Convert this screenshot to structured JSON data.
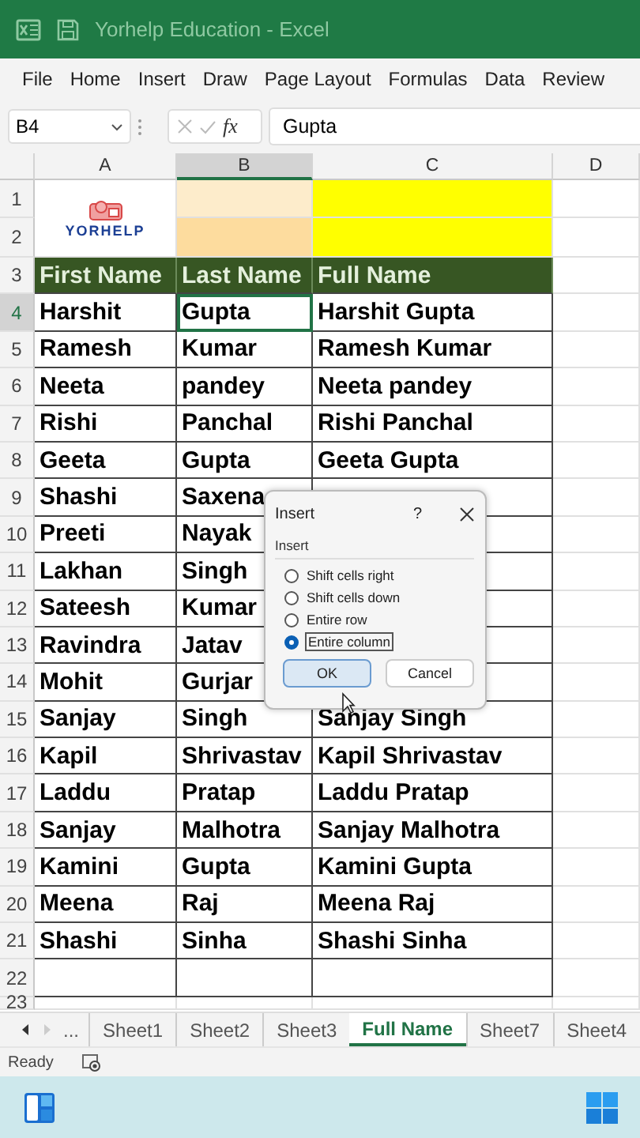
{
  "title_bar": {
    "title": "Yorhelp Education  -  Excel"
  },
  "menu": [
    "File",
    "Home",
    "Insert",
    "Draw",
    "Page Layout",
    "Formulas",
    "Data",
    "Review"
  ],
  "formula_bar": {
    "name_box": "B4",
    "function_label": "fx",
    "formula": "Gupta"
  },
  "columns": [
    {
      "label": "A",
      "selected": false
    },
    {
      "label": "B",
      "selected": true
    },
    {
      "label": "C",
      "selected": false
    },
    {
      "label": "D",
      "selected": false
    }
  ],
  "logo": {
    "text": "YORHELP"
  },
  "rows": [
    {
      "number": "1",
      "selected": false,
      "kind": "banner",
      "fills": [
        {
          "color": "#fdeccb"
        },
        {
          "color": "#ffff00"
        }
      ]
    },
    {
      "number": "2",
      "selected": false,
      "kind": "banner",
      "fills": [
        {
          "color": "#fddc9e"
        },
        {
          "color": "#ffff00"
        }
      ]
    },
    {
      "number": "3",
      "selected": false,
      "kind": "header",
      "cells": [
        "First Name",
        "Last Name",
        "Full Name"
      ]
    },
    {
      "number": "4",
      "selected": true,
      "kind": "data",
      "cells": [
        "Harshit",
        "Gupta",
        "Harshit Gupta"
      ]
    },
    {
      "number": "5",
      "selected": false,
      "kind": "data",
      "cells": [
        "Ramesh",
        "Kumar",
        "Ramesh Kumar"
      ]
    },
    {
      "number": "6",
      "selected": false,
      "kind": "data",
      "cells": [
        "Neeta",
        "pandey",
        "Neeta pandey"
      ]
    },
    {
      "number": "7",
      "selected": false,
      "kind": "data",
      "cells": [
        "Rishi",
        "Panchal",
        "Rishi Panchal"
      ]
    },
    {
      "number": "8",
      "selected": false,
      "kind": "data",
      "cells": [
        "Geeta",
        "Gupta",
        "Geeta Gupta"
      ]
    },
    {
      "number": "9",
      "selected": false,
      "kind": "data",
      "cells": [
        "Shashi",
        "Saxena"
      ]
    },
    {
      "number": "10",
      "selected": false,
      "kind": "data",
      "cells": [
        "Preeti",
        "Nayak"
      ]
    },
    {
      "number": "11",
      "selected": false,
      "kind": "data",
      "cells": [
        "Lakhan",
        "Singh"
      ]
    },
    {
      "number": "12",
      "selected": false,
      "kind": "data",
      "cells": [
        "Sateesh",
        "Kumar"
      ]
    },
    {
      "number": "13",
      "selected": false,
      "kind": "data",
      "cells": [
        "Ravindra",
        "Jatav"
      ]
    },
    {
      "number": "14",
      "selected": false,
      "kind": "data",
      "cells": [
        "Mohit",
        "Gurjar"
      ]
    },
    {
      "number": "15",
      "selected": false,
      "kind": "data",
      "cells": [
        "Sanjay",
        "Singh",
        "Sanjay Singh"
      ]
    },
    {
      "number": "16",
      "selected": false,
      "kind": "data",
      "cells": [
        "Kapil",
        "Shrivastav",
        "Kapil Shrivastav"
      ]
    },
    {
      "number": "17",
      "selected": false,
      "kind": "data",
      "cells": [
        "Laddu",
        "Pratap",
        "Laddu Pratap"
      ]
    },
    {
      "number": "18",
      "selected": false,
      "kind": "data",
      "cells": [
        "Sanjay",
        "Malhotra",
        "Sanjay Malhotra"
      ]
    },
    {
      "number": "19",
      "selected": false,
      "kind": "data",
      "cells": [
        "Kamini",
        "Gupta",
        "Kamini Gupta"
      ]
    },
    {
      "number": "20",
      "selected": false,
      "kind": "data",
      "cells": [
        "Meena",
        "Raj",
        "Meena Raj"
      ]
    },
    {
      "number": "21",
      "selected": false,
      "kind": "data",
      "cells": [
        "Shashi",
        "Sinha",
        "Shashi Sinha"
      ]
    },
    {
      "number": "22",
      "selected": false,
      "kind": "data"
    },
    {
      "number": "23",
      "selected": false,
      "kind": "blank"
    }
  ],
  "dialog": {
    "title": "Insert",
    "help": "?",
    "group_label": "Insert",
    "options": [
      {
        "label": "Shift cells right",
        "selected": false
      },
      {
        "label": "Shift cells down",
        "selected": false
      },
      {
        "label": "Entire row",
        "selected": false
      },
      {
        "label": "Entire column",
        "selected": true
      }
    ],
    "buttons": [
      {
        "label": "OK",
        "focused": true
      },
      {
        "label": "Cancel",
        "focused": false
      }
    ]
  },
  "sheet_tabs": {
    "overflow": "...",
    "tabs": [
      {
        "label": "Sheet1",
        "selected": false
      },
      {
        "label": "Sheet2",
        "selected": false
      },
      {
        "label": "Sheet3",
        "selected": false
      },
      {
        "label": "Full Name",
        "selected": true
      },
      {
        "label": "Sheet7",
        "selected": false
      },
      {
        "label": "Sheet4",
        "selected": false
      }
    ]
  },
  "status_bar": {
    "text": "Ready"
  }
}
